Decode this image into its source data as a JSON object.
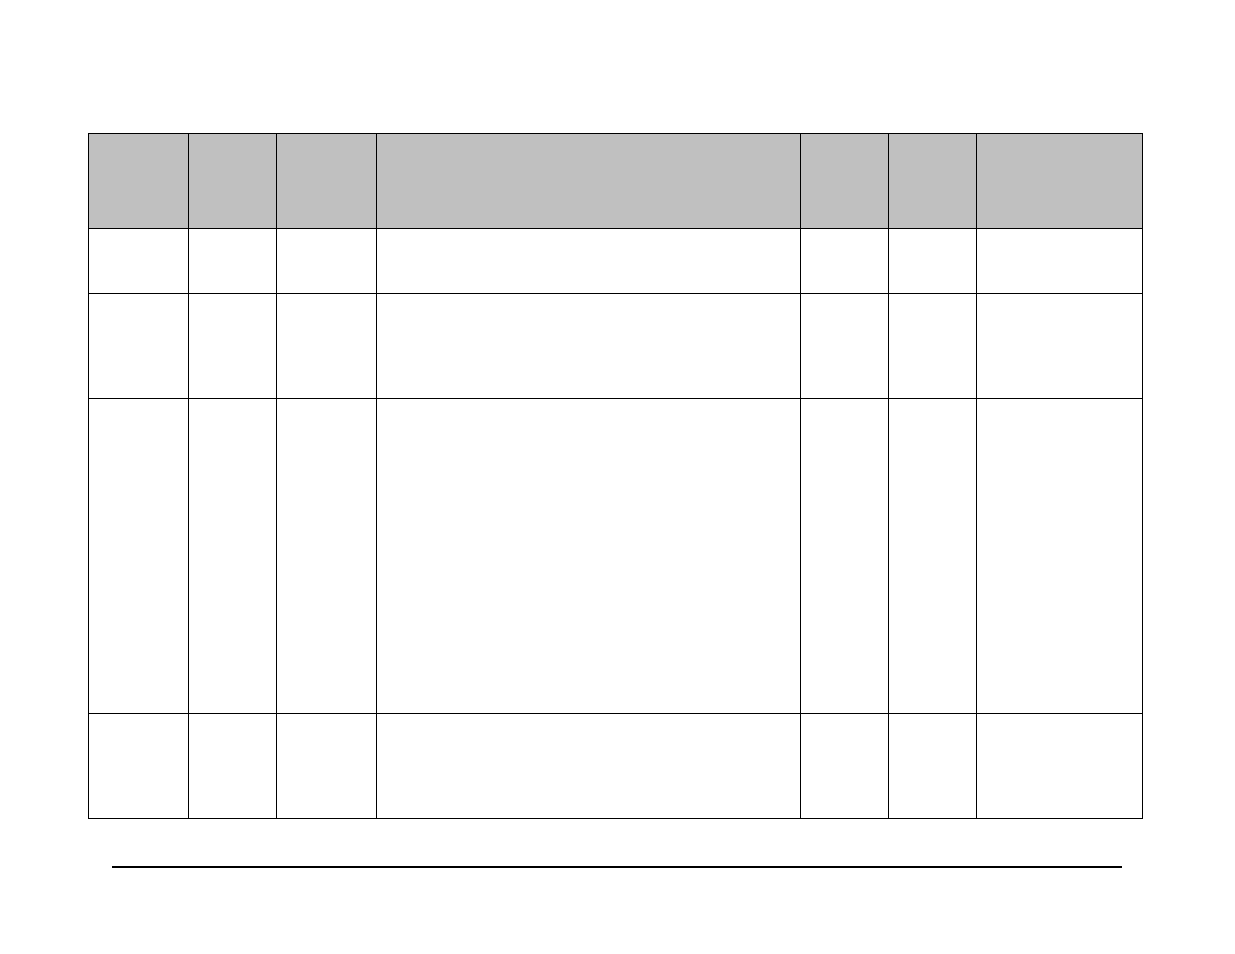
{
  "table": {
    "headers": [
      "",
      "",
      "",
      "",
      "",
      "",
      ""
    ],
    "rows": [
      [
        "",
        "",
        "",
        "",
        "",
        "",
        ""
      ],
      [
        "",
        "",
        "",
        "",
        "",
        "",
        ""
      ],
      [
        "",
        "",
        "",
        "",
        "",
        "",
        ""
      ],
      [
        "",
        "",
        "",
        "",
        "",
        "",
        ""
      ]
    ]
  }
}
